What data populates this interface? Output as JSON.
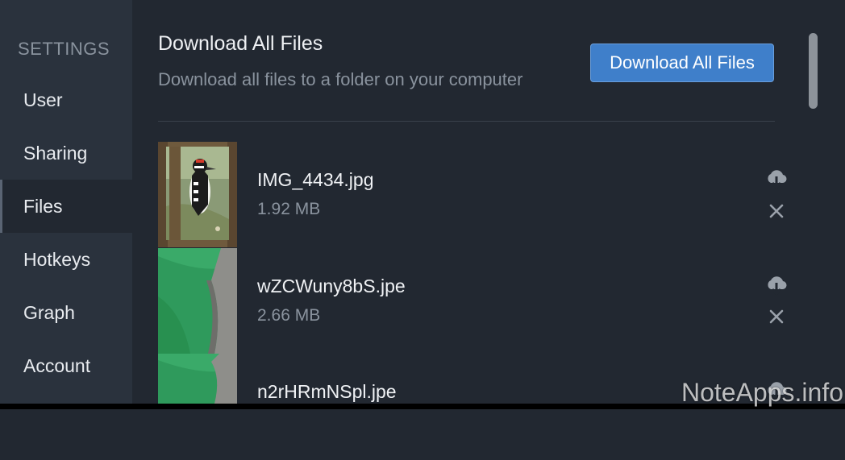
{
  "sidebar": {
    "heading": "SETTINGS",
    "items": [
      {
        "label": "User"
      },
      {
        "label": "Sharing"
      },
      {
        "label": "Files",
        "active": true
      },
      {
        "label": "Hotkeys"
      },
      {
        "label": "Graph"
      },
      {
        "label": "Account"
      }
    ]
  },
  "download_section": {
    "title": "Download All Files",
    "description": "Download all files to a folder on your computer",
    "button_label": "Download All Files"
  },
  "files": [
    {
      "name": "IMG_4434.jpg",
      "size": "1.92 MB",
      "thumbnail": "woodpecker-painting",
      "download_icon": "cloud-download-icon",
      "delete_icon": "close-icon"
    },
    {
      "name": "wZCWuny8bS.jpe",
      "size": "2.66 MB",
      "thumbnail": "green-fabric-photo",
      "download_icon": "cloud-download-icon",
      "delete_icon": "close-icon"
    },
    {
      "name": "n2rHRmNSpl.jpe",
      "thumbnail": "green-fabric-photo",
      "download_icon": "cloud-download-icon"
    }
  ],
  "watermark": "NoteApps.info",
  "colors": {
    "background": "#222831",
    "sidebar": "#2a323d",
    "accent": "#3f7fca",
    "muted_text": "#8a939e"
  }
}
